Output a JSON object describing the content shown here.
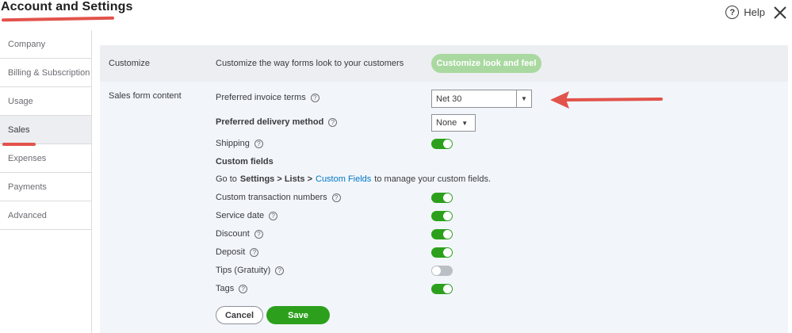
{
  "page": {
    "title": "Account and Settings",
    "help_label": "Help"
  },
  "colors": {
    "accent_green": "#2ca01c",
    "annotation_red": "#e2534b",
    "link_blue": "#0077c5"
  },
  "sidebar": {
    "items": [
      {
        "label": "Company"
      },
      {
        "label": "Billing & Subscription"
      },
      {
        "label": "Usage"
      },
      {
        "label": "Sales",
        "active": true
      },
      {
        "label": "Expenses"
      },
      {
        "label": "Payments"
      },
      {
        "label": "Advanced"
      }
    ]
  },
  "customize": {
    "label": "Customize",
    "description": "Customize the way forms look to your customers",
    "button_label": "Customize look and feel"
  },
  "sales_form": {
    "label": "Sales form content",
    "invoice_terms": {
      "label": "Preferred invoice terms",
      "value": "Net 30"
    },
    "delivery_method": {
      "label": "Preferred delivery method",
      "value": "None"
    },
    "shipping": {
      "label": "Shipping",
      "on": true
    },
    "custom_fields": {
      "heading": "Custom fields",
      "go_to": "Go to",
      "path": "Settings > Lists >",
      "link": "Custom Fields",
      "suffix": "to manage your custom fields."
    },
    "toggles": [
      {
        "label": "Custom transaction numbers",
        "on": true
      },
      {
        "label": "Service date",
        "on": true
      },
      {
        "label": "Discount",
        "on": true
      },
      {
        "label": "Deposit",
        "on": true
      },
      {
        "label": "Tips (Gratuity)",
        "on": false
      },
      {
        "label": "Tags",
        "on": true
      }
    ],
    "cancel_label": "Cancel",
    "save_label": "Save"
  }
}
